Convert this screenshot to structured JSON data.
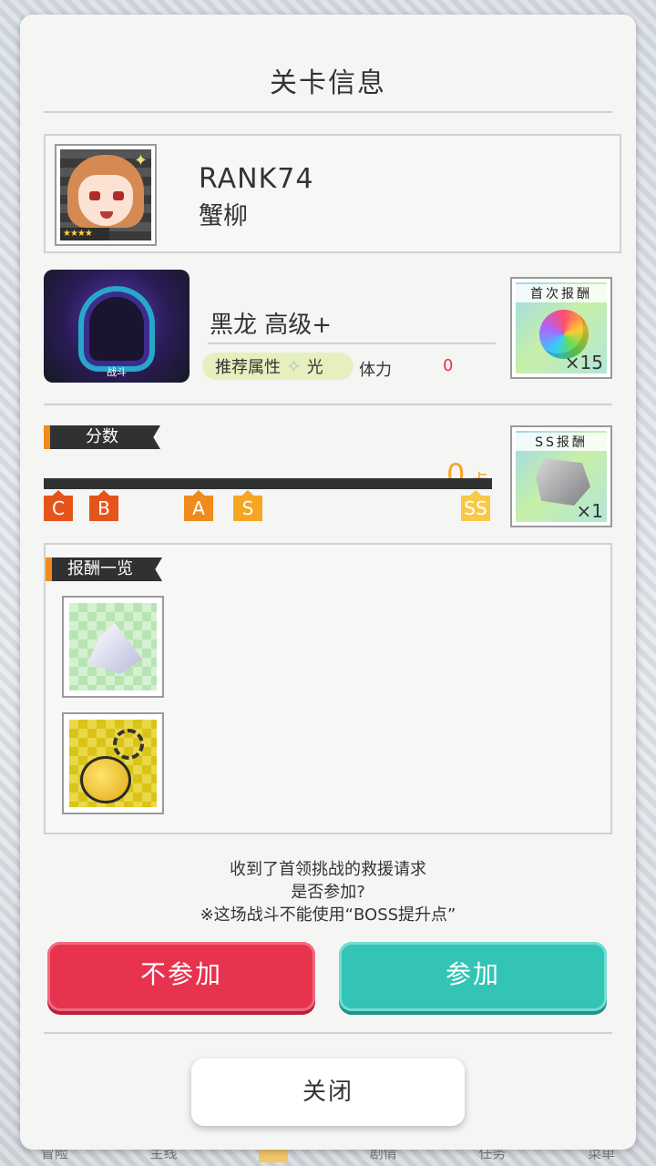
{
  "background_nav": [
    "冒险",
    "主线",
    "",
    "剧情",
    "任务",
    "菜单"
  ],
  "dialog": {
    "title": "关卡信息",
    "player": {
      "rank": "RANK74",
      "name": "蟹柳",
      "stars": "★★★★"
    },
    "boss": {
      "image_caption": "战斗",
      "name": "黑龙 高级+",
      "attr_label": "推荐属性",
      "attr_value": "光",
      "stamina_label": "体力",
      "stamina_value": "0"
    },
    "first_reward": {
      "label": "首次报酬",
      "qty": "×15"
    },
    "ss_reward": {
      "label": "SS报酬",
      "qty": "×1"
    },
    "score": {
      "label": "分数",
      "value": "0",
      "unit": "点",
      "markers": [
        {
          "rank": "C",
          "color": "#e5551b"
        },
        {
          "rank": "B",
          "color": "#e5551b"
        },
        {
          "rank": "A",
          "color": "#f08a1c"
        },
        {
          "rank": "S",
          "color": "#f5a623"
        },
        {
          "rank": "SS",
          "color": "#f7c948"
        }
      ]
    },
    "reward_list": {
      "label": "报酬一览"
    },
    "message": {
      "line1": "收到了首领挑战的救援请求",
      "line2": "是否参加?",
      "line3": "※这场战斗不能使用“BOSS提升点”"
    },
    "buttons": {
      "decline": "不参加",
      "join": "参加",
      "close": "关闭"
    }
  }
}
